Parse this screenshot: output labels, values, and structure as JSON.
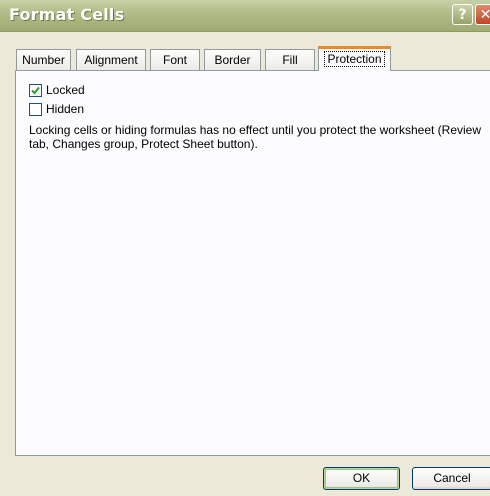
{
  "window": {
    "title": "Format Cells"
  },
  "titlebar": {
    "help_label": "?",
    "close_label": "✕"
  },
  "tabs": [
    {
      "label": "Number",
      "active": false
    },
    {
      "label": "Alignment",
      "active": false
    },
    {
      "label": "Font",
      "active": false
    },
    {
      "label": "Border",
      "active": false
    },
    {
      "label": "Fill",
      "active": false
    },
    {
      "label": "Protection",
      "active": true
    }
  ],
  "protection": {
    "locked": {
      "label": "Locked",
      "checked": true
    },
    "hidden": {
      "label": "Hidden",
      "checked": false
    },
    "description": "Locking cells or hiding formulas has no effect until you protect the worksheet (Review tab, Changes group, Protect Sheet button)."
  },
  "buttons": {
    "ok": "OK",
    "cancel": "Cancel"
  },
  "colors": {
    "title_bar": "#B0BB86",
    "active_tab_accent": "#E68B2C",
    "dialog_bg": "#ECE9D8",
    "checkbox_border": "#1C5180"
  }
}
